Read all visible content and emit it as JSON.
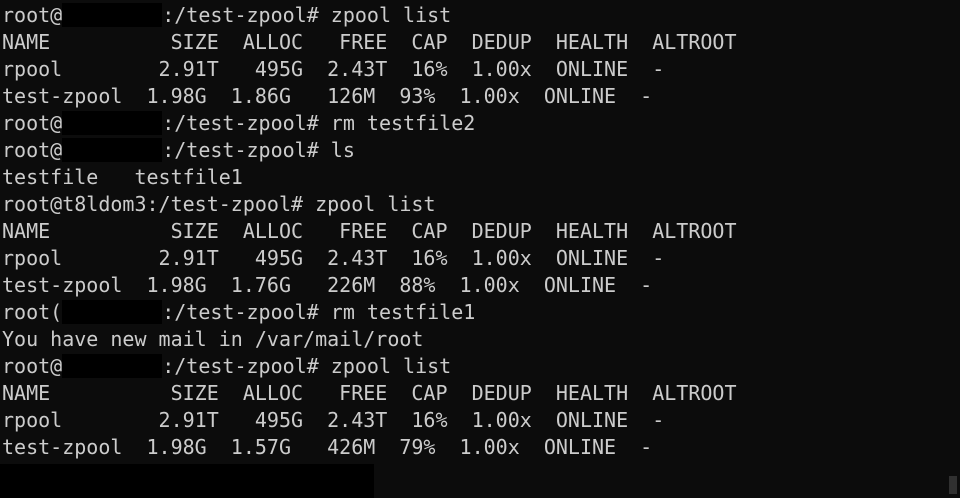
{
  "terminal": {
    "l01": {
      "prompt_user": "root@",
      "prompt_path": ":/test-zpool# ",
      "command": "zpool list"
    },
    "l02": {
      "text": "NAME          SIZE  ALLOC   FREE  CAP  DEDUP  HEALTH  ALTROOT"
    },
    "l03": {
      "text": "rpool        2.91T   495G  2.43T  16%  1.00x  ONLINE  -"
    },
    "l04": {
      "text": "test-zpool  1.98G  1.86G   126M  93%  1.00x  ONLINE  -"
    },
    "l05": {
      "prompt_user": "root@",
      "prompt_path": ":/test-zpool# ",
      "command": "rm testfile2"
    },
    "l06": {
      "prompt_user": "root@",
      "prompt_path": ":/test-zpool# ",
      "command": "ls"
    },
    "l07": {
      "text": "testfile   testfile1"
    },
    "l08": {
      "prompt": "root@t8ldom3:/test-zpool# ",
      "command": "zpool list"
    },
    "l09": {
      "text": "NAME          SIZE  ALLOC   FREE  CAP  DEDUP  HEALTH  ALTROOT"
    },
    "l10": {
      "text": "rpool        2.91T   495G  2.43T  16%  1.00x  ONLINE  -"
    },
    "l11": {
      "text": "test-zpool  1.98G  1.76G   226M  88%  1.00x  ONLINE  -"
    },
    "l12": {
      "prompt_user": "root(",
      "prompt_path": ":/test-zpool# ",
      "command": "rm testfile1"
    },
    "l13": {
      "text": "You have new mail in /var/mail/root"
    },
    "l14": {
      "prompt_user": "root@",
      "prompt_path": ":/test-zpool# ",
      "command": "zpool list"
    },
    "l15": {
      "text": "NAME          SIZE  ALLOC   FREE  CAP  DEDUP  HEALTH  ALTROOT"
    },
    "l16": {
      "text": "rpool        2.91T   495G  2.43T  16%  1.00x  ONLINE  -"
    },
    "l17": {
      "text": "test-zpool  1.98G  1.57G   426M  79%  1.00x  ONLINE  -"
    }
  },
  "colors": {
    "background": "#0c0c0c",
    "foreground": "#cccccc",
    "redaction": "#000000"
  }
}
